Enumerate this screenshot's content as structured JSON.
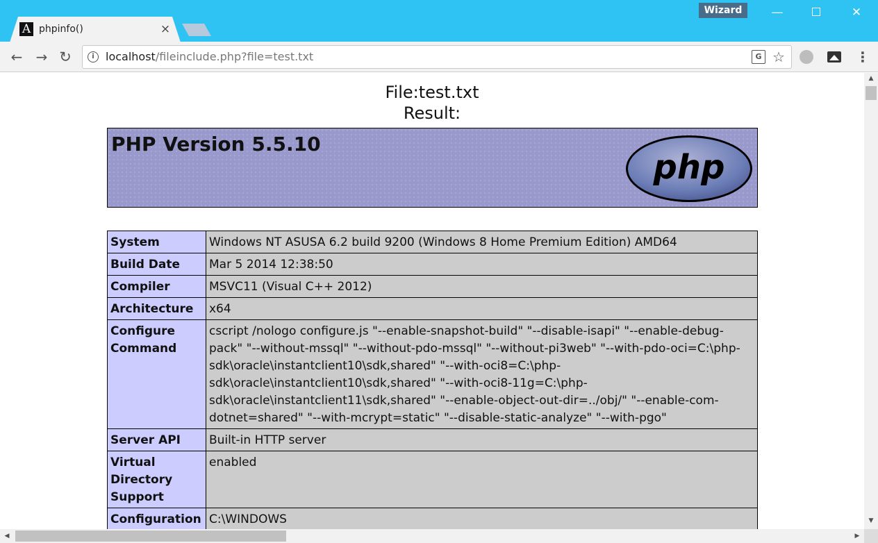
{
  "window": {
    "profile_badge": "Wizard",
    "minimize_glyph": "—",
    "close_glyph": "✕"
  },
  "tab": {
    "favicon_glyph": "A",
    "title": "phpinfo()",
    "close_glyph": "×"
  },
  "toolbar": {
    "back_glyph": "←",
    "forward_glyph": "→",
    "reload_glyph": "↻",
    "info_glyph": "i",
    "url_host": "localhost",
    "url_path": "/fileinclude.php?file=test.txt",
    "translate_glyph": "G",
    "star_glyph": "☆",
    "menu_glyph": "⋮"
  },
  "page": {
    "file_line": "File:test.txt",
    "result_line": "Result:",
    "php_version": "PHP Version 5.5.10",
    "php_logo_text": "php",
    "info_rows": [
      {
        "label": "System",
        "value": "Windows NT ASUSA 6.2 build 9200 (Windows 8 Home Premium Edition) AMD64"
      },
      {
        "label": "Build Date",
        "value": "Mar 5 2014 12:38:50"
      },
      {
        "label": "Compiler",
        "value": "MSVC11 (Visual C++ 2012)"
      },
      {
        "label": "Architecture",
        "value": "x64"
      },
      {
        "label": "Configure Command",
        "value": "cscript /nologo configure.js \"--enable-snapshot-build\" \"--disable-isapi\" \"--enable-debug-pack\" \"--without-mssql\" \"--without-pdo-mssql\" \"--without-pi3web\" \"--with-pdo-oci=C:\\php-sdk\\oracle\\instantclient10\\sdk,shared\" \"--with-oci8=C:\\php-sdk\\oracle\\instantclient10\\sdk,shared\" \"--with-oci8-11g=C:\\php-sdk\\oracle\\instantclient11\\sdk,shared\" \"--enable-object-out-dir=../obj/\" \"--enable-com-dotnet=shared\" \"--with-mcrypt=static\" \"--disable-static-analyze\" \"--with-pgo\""
      },
      {
        "label": "Server API",
        "value": "Built-in HTTP server"
      },
      {
        "label": "Virtual Directory Support",
        "value": "enabled"
      },
      {
        "label": "Configuration",
        "value": "C:\\WINDOWS"
      }
    ]
  },
  "scrollbars": {
    "up_glyph": "▲",
    "down_glyph": "▼",
    "left_glyph": "◀",
    "right_glyph": "▶"
  },
  "colors": {
    "titlebar": "#2ec3f3",
    "php_header_bg": "#9999cc",
    "label_cell_bg": "#ccccff",
    "value_cell_bg": "#cccccc"
  },
  "icons": [
    "tab-favicon-icon",
    "close-tab-icon",
    "back-arrow-icon",
    "forward-arrow-icon",
    "reload-icon",
    "info-icon",
    "translate-icon",
    "star-icon",
    "globe-extension-icon",
    "image-extension-icon",
    "menu-icon"
  ]
}
